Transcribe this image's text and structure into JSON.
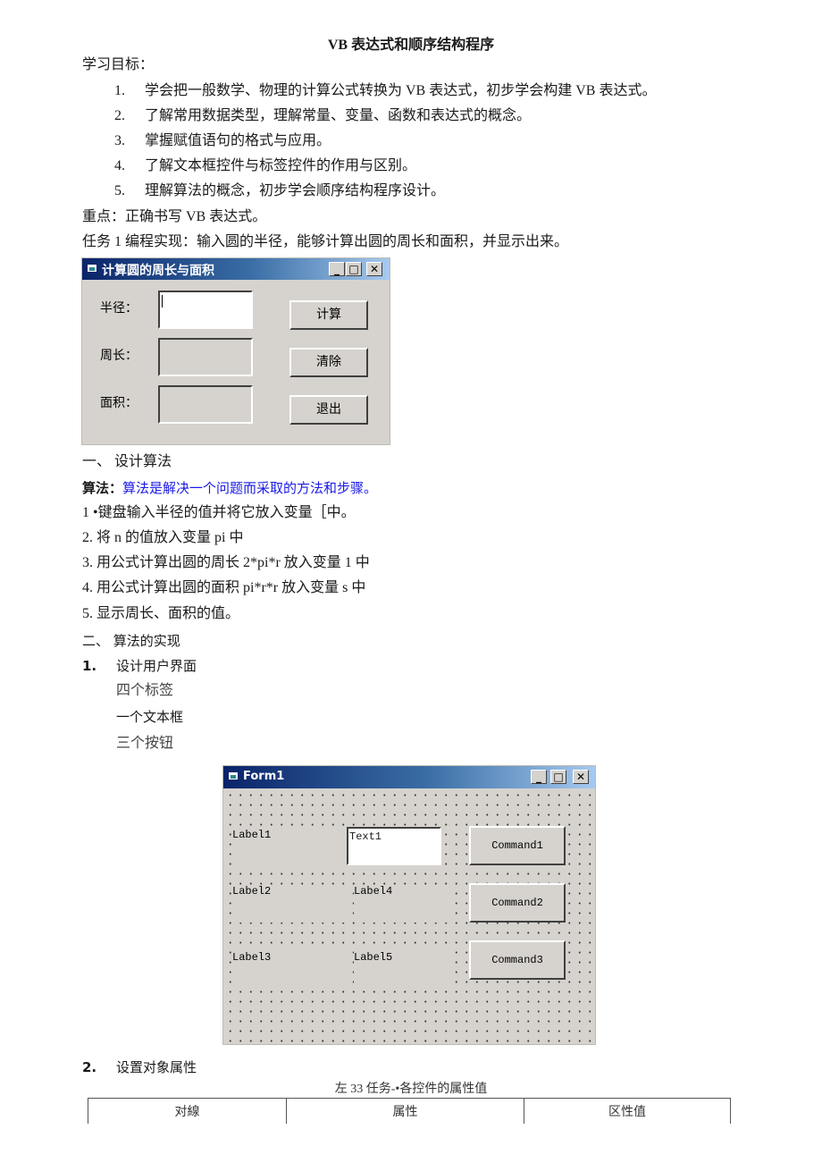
{
  "doc": {
    "title": "VB 表达式和顺序结构程序",
    "objectives_heading": "学习目标：",
    "objectives": [
      {
        "num": "1.",
        "text": "学会把一般数学、物理的计算公式转换为 VB 表达式，初步学会构建 VB 表达式。"
      },
      {
        "num": "2.",
        "text": "了解常用数据类型，理解常量、变量、函数和表达式的概念。"
      },
      {
        "num": "3.",
        "text": "掌握赋值语句的格式与应用。"
      },
      {
        "num": "4.",
        "text": "了解文本框控件与标签控件的作用与区别。"
      },
      {
        "num": "5.",
        "text": "理解算法的概念，初步学会顺序结构程序设计。"
      }
    ],
    "key_point": "重点：正确书写 VB 表达式。",
    "task": "任务 1 编程实现：输入圆的半径，能够计算出圆的周长和面积，并显示出来。",
    "section1": "一、 设计算法",
    "algo_label": "算法：",
    "algo_def": "算法是解决一个问题而采取的方法和步骤。",
    "steps": [
      "1 •键盘输入半径的值并将它放入变量［中。",
      "2. 将 n 的值放入变量 pi 中",
      "3. 用公式计算出圆的周长 2*pi*r 放入变量 1 中",
      "4. 用公式计算出圆的面积 pi*r*r 放入变量 s 中",
      "5. 显示周长、面积的值。"
    ],
    "section2": "二、 算法的实现",
    "sub1_num": "1.",
    "sub1_text": "设计用户界面",
    "ui_items": [
      "四个标签",
      "一个文本框",
      "三个按钮"
    ],
    "sub2_num": "2.",
    "sub2_text": "设置对象属性",
    "table_caption": "左 33 任务-•各控件的属性值",
    "table_headers": [
      "对線",
      "属性",
      "区性值"
    ]
  },
  "window1": {
    "title": "计算圆的周长与面积",
    "labels": [
      "半径：",
      "周长：",
      "面积："
    ],
    "buttons": [
      "计算",
      "清除",
      "退出"
    ],
    "controls": {
      "minimize": "_",
      "maximize": "□",
      "close": "✕"
    }
  },
  "window2": {
    "title": "Form1",
    "labels": [
      "Label1",
      "Label2",
      "Label3",
      "Label4",
      "Label5"
    ],
    "textbox": "Text1",
    "buttons": [
      "Command1",
      "Command2",
      "Command3"
    ],
    "controls": {
      "minimize": "_",
      "maximize": "□",
      "close": "✕"
    }
  }
}
